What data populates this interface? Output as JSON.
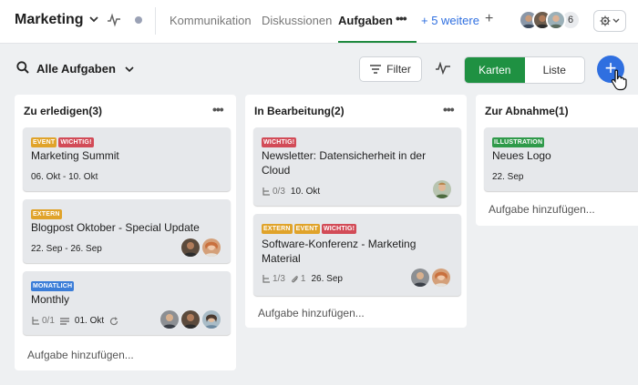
{
  "header": {
    "project": "Marketing",
    "tabs": [
      "Kommunikation",
      "Diskussionen",
      "Aufgaben"
    ],
    "more_tabs": "+ 5 weitere",
    "member_count": "6"
  },
  "toolbar": {
    "view_title": "Alle Aufgaben",
    "filter_label": "Filter",
    "view_cards": "Karten",
    "view_list": "Liste"
  },
  "columns": [
    {
      "title": "Zu erledigen(3)",
      "add_task": "Aufgabe hinzufügen...",
      "cards": [
        {
          "tags": [
            "EVENT",
            "WICHTIG!"
          ],
          "title": "Marketing Summit",
          "date": "06. Okt - 10. Okt"
        },
        {
          "tags": [
            "EXTERN"
          ],
          "title": "Blogpost Oktober - Special Update",
          "date": "22. Sep - 26. Sep"
        },
        {
          "tags": [
            "MONATLICH"
          ],
          "title": "Monthly",
          "subtasks": "0/1",
          "date": "01. Okt"
        }
      ]
    },
    {
      "title": "In Bearbeitung(2)",
      "add_task": "Aufgabe hinzufügen...",
      "cards": [
        {
          "tags": [
            "WICHTIG!"
          ],
          "title_line1": "Newsletter: Datensicherheit in der",
          "title_line2": "Cloud",
          "subtasks": "0/3",
          "date": "10. Okt"
        },
        {
          "tags": [
            "EXTERN",
            "EVENT",
            "WICHTIG!"
          ],
          "title_line1": "Software-Konferenz - Marketing",
          "title_line2": "Material",
          "subtasks": "1/3",
          "attachments": "1",
          "date": "26. Sep"
        }
      ]
    },
    {
      "title": "Zur Abnahme(1)",
      "add_task": "Aufgabe hinzufügen...",
      "cards": [
        {
          "tags": [
            "ILLUSTRATION"
          ],
          "title": "Neues Logo",
          "date": "22. Sep"
        }
      ]
    }
  ],
  "colors": {
    "accent_green": "#1f9142",
    "accent_blue": "#2f6fe0",
    "tag_orange": "#e0a32a",
    "tag_red": "#d24b57",
    "tag_blue": "#3b7dd8",
    "tag_green": "#2f9a4a"
  },
  "icons": [
    "chevron-down-icon",
    "activity-icon",
    "status-dot-icon",
    "ellipsis-icon",
    "plus-icon",
    "gear-icon",
    "search-icon",
    "filter-icon",
    "subtask-icon",
    "paperclip-icon",
    "description-icon",
    "recurring-icon",
    "pointer-cursor-icon"
  ]
}
